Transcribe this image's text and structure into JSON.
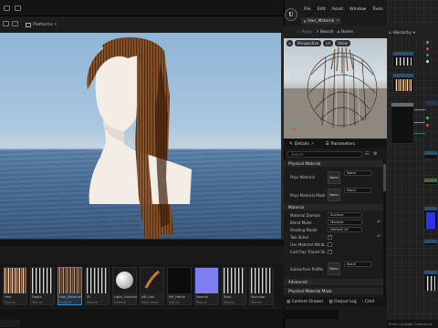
{
  "level_editor": {
    "toolbar": {
      "platforms_label": "Platforms"
    }
  },
  "content_browser": {
    "assets": [
      {
        "name": "Hair",
        "type": "Texture",
        "style": "hairs",
        "selected": false
      },
      {
        "name": "Depth",
        "type": "Texture",
        "style": "hairs-dark",
        "selected": false
      },
      {
        "name": "Hair_Material",
        "type": "Material",
        "style": "hairs-sel",
        "selected": true
      },
      {
        "name": "ID",
        "type": "Texture",
        "style": "hairs-dark",
        "selected": false
      },
      {
        "name": "Light_Function",
        "type": "Material",
        "style": "sphere",
        "selected": false
      },
      {
        "name": "NH_Hair",
        "type": "Static Mesh",
        "style": "strand",
        "selected": false
      },
      {
        "name": "NH_Hairte",
        "type": "Texture",
        "style": "dark",
        "selected": false
      },
      {
        "name": "Normal",
        "type": "Texture",
        "style": "normal",
        "selected": false
      },
      {
        "name": "Root",
        "type": "Texture",
        "style": "hairs-dark",
        "selected": false
      },
      {
        "name": "Specular",
        "type": "Texture",
        "style": "hairs-dark",
        "selected": false
      }
    ]
  },
  "material_editor": {
    "menu": [
      "File",
      "Edit",
      "Asset",
      "Window",
      "Tools",
      "Help"
    ],
    "tab_label": "Hair_Material",
    "toolbar": [
      {
        "label": "Apply",
        "dim": true
      },
      {
        "label": "Search",
        "dim": false
      },
      {
        "label": "Home",
        "dim": false
      }
    ],
    "graph_toolbar_label": "Hierarchy",
    "preview_buttons": [
      "Perspective",
      "Lit",
      "Show"
    ],
    "details_tabs": {
      "details": "Details",
      "parameters": "Parameters"
    },
    "search_placeholder": "Search",
    "sections": {
      "physical_material": "Physical Material",
      "material": "Material",
      "advanced": "Advanced",
      "physical_mask": "Physical Material Mask"
    },
    "properties": {
      "phys_material": "Phys Material",
      "phys_material_value": "None",
      "phys_material_mask": "Phys Material Mask",
      "phys_material_mask_value": "None",
      "material_domain": "Material Domain",
      "material_domain_value": "Surface",
      "blend_mode": "Blend Mode",
      "blend_mode_value": "Masked",
      "shading_model": "Shading Model",
      "shading_model_value": "Default Lit",
      "two_sided": "Two Sided",
      "two_sided_checked": true,
      "use_material_attr": "Use Material Attrib...",
      "use_material_attr_checked": false,
      "cast_ray_traced": "Cast Ray Traced Sh...",
      "cast_ray_traced_checked": true,
      "subsurface_profile": "Subsurface Profile",
      "subsurface_profile_value": "None",
      "swatch_label": "None"
    },
    "bottom_tabs": [
      "Content Drawer",
      "Output Log",
      "Cmd"
    ],
    "command_placeholder": "Enter Console Command"
  },
  "colors": {
    "accent_blue": "#2f8fd6",
    "hair_brown": "#7a4320",
    "sky": "#a9c7df",
    "water": "#4b6f99",
    "bust": "#f3ede6"
  }
}
